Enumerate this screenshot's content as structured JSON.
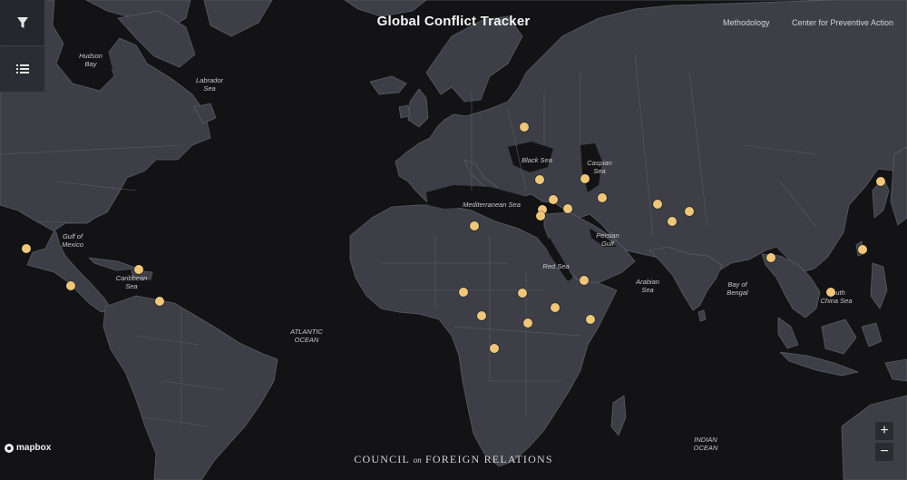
{
  "header": {
    "title": "Global Conflict Tracker",
    "links": [
      "Methodology",
      "Center for Preventive Action"
    ]
  },
  "sidebar": {
    "buttons": [
      {
        "icon": "filter-icon"
      },
      {
        "icon": "list-icon"
      }
    ]
  },
  "map": {
    "colors": {
      "ocean": "#131315",
      "land": "#3e3f46",
      "border": "#5a5b63",
      "marker": "#efc77a"
    },
    "water_labels": [
      "Hudson\nBay",
      "Labrador\nSea",
      "Gulf of\nMexico",
      "Caribbean\nSea",
      "ATLANTIC\nOCEAN",
      "Mediterranean Sea",
      "Black Sea",
      "Caspian\nSea",
      "Persian\nGulf",
      "Red Sea",
      "Arabian\nSea",
      "Bay of\nBengal",
      "South\nChina Sea",
      "INDIAN\nOCEAN"
    ],
    "conflict_markers": 31
  },
  "zoom": {
    "in": "+",
    "out": "−"
  },
  "attribution": "mapbox",
  "footer": {
    "left": "COUNCIL",
    "middle": "on",
    "right": "FOREIGN RELATIONS"
  }
}
